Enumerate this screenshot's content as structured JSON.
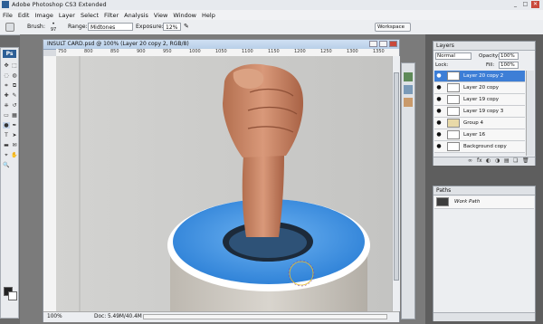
{
  "app": {
    "title": "Adobe Photoshop CS3 Extended",
    "logo": "Ps",
    "window_buttons": [
      "_",
      "□",
      "✕"
    ]
  },
  "menu": [
    "File",
    "Edit",
    "Image",
    "Layer",
    "Select",
    "Filter",
    "Analysis",
    "View",
    "Window",
    "Help"
  ],
  "options": {
    "brush_label": "Brush:",
    "brush_size": "97",
    "range_label": "Range:",
    "range_value": "Midtones",
    "exposure_label": "Exposure:",
    "exposure_value": "12%",
    "workspace_label": "Workspace"
  },
  "document": {
    "title": "INSULT CARD.psd @ 100% (Layer 20 copy 2, RGB/8)",
    "ruler_ticks": [
      "750",
      "800",
      "850",
      "900",
      "950",
      "1000",
      "1050",
      "1100",
      "1150",
      "1200",
      "1250",
      "1300",
      "1350"
    ],
    "zoom": "100%",
    "doc_size": "Doc: 5.49M/40.4M"
  },
  "layers_panel": {
    "tab": "Layers",
    "blend_mode": "Normal",
    "opacity_label": "Opacity:",
    "opacity_value": "100%",
    "lock_label": "Lock:",
    "fill_label": "Fill:",
    "fill_value": "100%",
    "layers": [
      {
        "name": "Layer 20 copy 2",
        "selected": true
      },
      {
        "name": "Layer 20 copy",
        "selected": false
      },
      {
        "name": "Layer 19 copy",
        "selected": false
      },
      {
        "name": "Layer 19 copy 3",
        "selected": false
      },
      {
        "name": "Group 4",
        "selected": false
      },
      {
        "name": "Layer 16",
        "selected": false
      },
      {
        "name": "Background copy",
        "selected": false
      }
    ],
    "footer_icons": [
      "link-icon",
      "fx-icon",
      "mask-icon",
      "adjustment-icon",
      "folder-icon",
      "new-layer-icon",
      "trash-icon"
    ]
  },
  "paths_panel": {
    "tab": "Paths",
    "items": [
      "Work Path"
    ]
  },
  "colors": {
    "accent_blue": "#3d7ed6",
    "tube_blue": "#3b8de0"
  }
}
